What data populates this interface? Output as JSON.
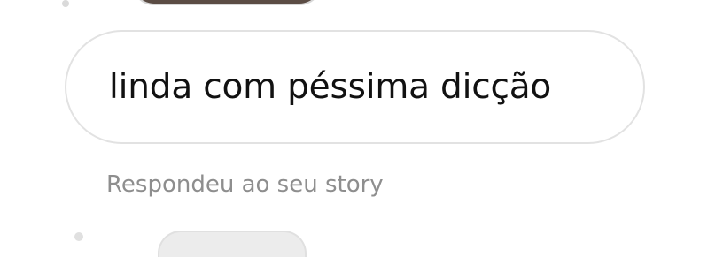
{
  "message": {
    "text": "linda com péssima dicção"
  },
  "reply": {
    "caption": "Respondeu ao seu story"
  },
  "colors": {
    "bubble_border": "#e2e2e2",
    "caption_text": "#8e8e8e",
    "message_text": "#111111"
  }
}
